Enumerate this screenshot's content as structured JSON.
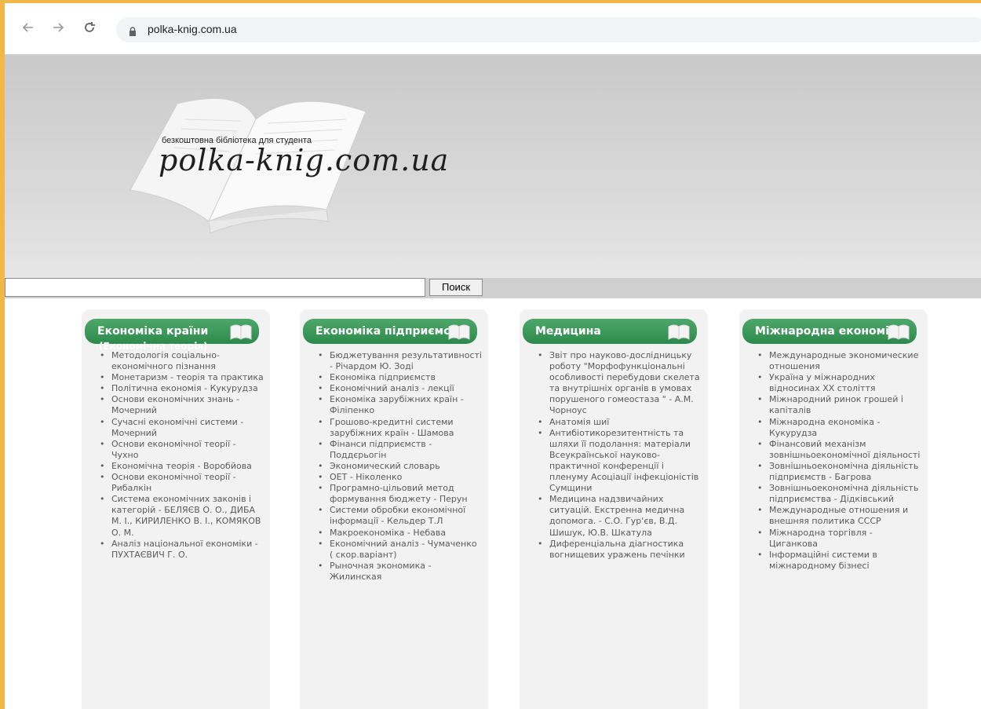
{
  "browser": {
    "back_icon": "back-arrow-icon",
    "forward_icon": "forward-arrow-icon",
    "reload_icon": "reload-icon",
    "lock_icon": "lock-icon",
    "url": "polka-knig.com.ua"
  },
  "header": {
    "tagline": "безкоштовна бібліотека для студента",
    "logo": "polka-knig.com.ua"
  },
  "search": {
    "value": "",
    "button_label": "Поиск"
  },
  "columns": [
    {
      "title": "Економіка країни",
      "subtitle": "(Економічна теорія)",
      "items": [
        "Методологія соціально-економічного пізнання",
        "Монетаризм - теорія та практика",
        "Політична економія - Кукурудза",
        "Основи економічних знань - Мочерний",
        "Сучасні економічні системи - Мочерний",
        "Основи економічної теорії - Чухно",
        "Економічна теорія - Воробйова",
        "Основи економічної теорії - Рибалкін",
        "Система економічних законів і категорій - БЕЛЯЄВ О. О., ДИБА М. І., КИРИЛЕНКО В. І., КОМЯКОВ О. М.",
        "Аналіз національної економіки - ПУХТАЄВИЧ Г. О."
      ]
    },
    {
      "title": "Економіка підприємств",
      "items": [
        "Бюджетування результативності - Річардом Ю. Зоді",
        "Економіка підприємств",
        "Економічний аналіз - лекції",
        "Економіка зарубіжних країн - Філіпенко",
        "Грошово-кредитні системи зарубіжних країн - Шамова",
        "Фінанси підприємств - Поддєрьогін",
        "Экономический словарь",
        "ОЕТ - Ніколенко",
        "Програмно-цільовий метод формування бюджету - Перун",
        "Системи обробки економічної інформації - Кельдер Т.Л",
        "Макроекономіка - Небава",
        "Економічний аналіз - Чумаченко ( скор.варіант)",
        "Рыночная экономика - Жилинская"
      ]
    },
    {
      "title": "Медицина",
      "items": [
        "Звіт про науково-дослідницьку роботу \"Морфофункціональні особливості перебудови скелета та внутрішніх органів в умовах порушеного гомеостаза \" - А.М. Чорноус",
        "Анатомія шиї",
        "Антибіотикорезитентність та шляхи її подолання: матеріали Всеукраїнської науково-практичної конференції і пленуму Асоціації інфекціоністів Сумщини",
        "Медицина надзвичайних ситуацій. Екстренна медична допомога. - С.О. Гур'єв, В.Д. Шишук, Ю.В. Шкатула",
        "Диференціальна діагностика вогнищевих уражень печінки"
      ]
    },
    {
      "title": "Міжнародна економіка",
      "items": [
        "Международные экономические отношения",
        "Україна у міжнародних відносинах XX століття",
        "Міжнародний ринок грошей і капіталів",
        "Міжнародна економіка - Кукурудза",
        "Фінансовий механізм зовнішньоекономічної діяльності",
        "Зовнішньоекономічна діяльність підприємств - Багрова",
        "Зовнішньоекономічна діяльність підприємства - Дідківський",
        "Международные отношения и внешняя политика СССР",
        "Міжнародна торгівля - Циганкова",
        "Інформаційні системи в міжнародному бізнесі"
      ]
    }
  ],
  "colors": {
    "accent_green": "#2e8a4c",
    "frame": "#f0b84a"
  }
}
